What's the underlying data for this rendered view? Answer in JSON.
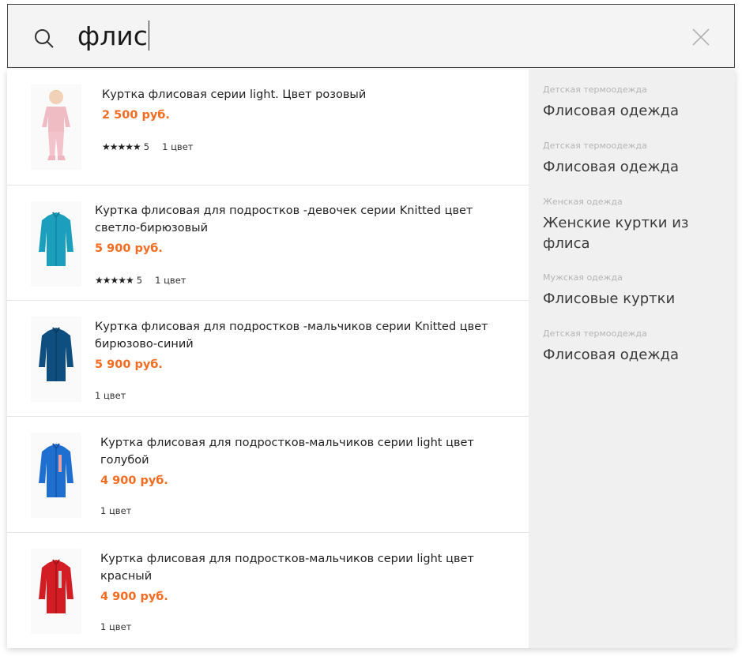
{
  "search": {
    "query": "флис"
  },
  "results": [
    {
      "title": "Куртка флисовая серии light. Цвет розовый",
      "price": "2 500 руб.",
      "rating": "5",
      "colors": "1 цвет",
      "image": "pink-fleece-kid"
    },
    {
      "title": "Куртка флисовая для подростков -девочек серии Knitted цвет светло-бирюзовый",
      "price": "5 900 руб.",
      "rating": "5",
      "colors": "1 цвет",
      "image": "turquoise-jacket"
    },
    {
      "title": "Куртка флисовая для подростков -мальчиков серии Knitted цвет бирюзово-синий",
      "price": "5 900 руб.",
      "colors": "1 цвет",
      "image": "teal-blue-jacket"
    },
    {
      "title": "Куртка флисовая для подростков-мальчиков серии light цвет голубой",
      "price": "4 900 руб.",
      "colors": "1 цвет",
      "image": "blue-jacket"
    },
    {
      "title": "Куртка флисовая для подростков-мальчиков серии light цвет красный",
      "price": "4 900 руб.",
      "colors": "1 цвет",
      "image": "red-jacket"
    }
  ],
  "categories": [
    {
      "label": "Детская термоодежда",
      "name": "Флисовая одежда"
    },
    {
      "label": "Детская термоодежда",
      "name": "Флисовая одежда"
    },
    {
      "label": "Женская одежда",
      "name": "Женские куртки из флиса"
    },
    {
      "label": "Мужская одежда",
      "name": "Флисовые куртки"
    },
    {
      "label": "Детская термоодежда",
      "name": "Флисовая одежда"
    }
  ],
  "colors": {
    "price": "#f36c21",
    "sidebar_bg": "#f0f0f0",
    "search_bg": "#f4f4f4"
  }
}
